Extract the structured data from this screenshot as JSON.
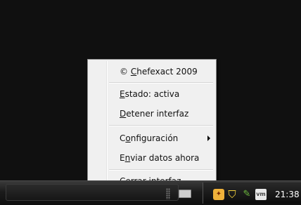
{
  "menu": {
    "items": [
      {
        "pre": "© ",
        "key": "C",
        "post": "hefexact 2009"
      },
      {
        "pre": "",
        "key": "E",
        "post": "stado: activa"
      },
      {
        "pre": "",
        "key": "D",
        "post": "etener interfaz"
      },
      {
        "pre": "C",
        "key": "o",
        "post": "nfiguración"
      },
      {
        "pre": "E",
        "key": "n",
        "post": "viar datos ahora"
      },
      {
        "pre": "Ce",
        "key": "r",
        "post": "rar interfaz"
      }
    ]
  },
  "taskbar": {
    "clock": "21:38",
    "tray_icons": [
      "chefexact-icon",
      "shield-icon",
      "tool-icon",
      "vm-icon"
    ],
    "vm_badge": "vm"
  },
  "colors": {
    "desktop": "#101010",
    "menu_bg": "#f0f0f0",
    "taskbar": "#1b1b1b"
  }
}
